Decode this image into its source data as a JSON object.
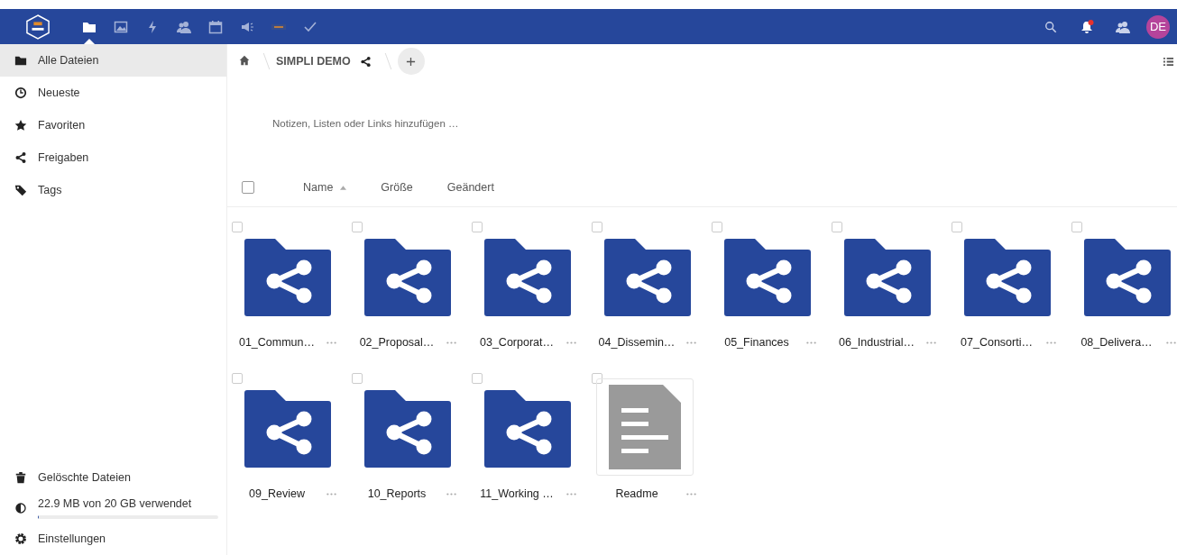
{
  "header": {
    "apps": [
      {
        "kind": "files",
        "selected": true
      },
      {
        "kind": "photos",
        "selected": false
      },
      {
        "kind": "activity",
        "selected": false
      },
      {
        "kind": "contacts",
        "selected": false
      },
      {
        "kind": "calendar",
        "selected": false
      },
      {
        "kind": "announce",
        "selected": false
      },
      {
        "kind": "badge",
        "selected": false
      },
      {
        "kind": "tasks",
        "selected": false
      }
    ],
    "notification_unread": true,
    "avatar": "DE"
  },
  "sidebar": {
    "items": [
      {
        "kind": "folder",
        "label": "Alle Dateien",
        "selected": true
      },
      {
        "kind": "clock",
        "label": "Neueste",
        "selected": false
      },
      {
        "kind": "star",
        "label": "Favoriten",
        "selected": false
      },
      {
        "kind": "share",
        "label": "Freigaben",
        "selected": false
      },
      {
        "kind": "tag",
        "label": "Tags",
        "selected": false
      }
    ],
    "trash": "Gelöschte Dateien",
    "quota": {
      "text": "22.9 MB von 20 GB verwendet",
      "level": 0.0011
    },
    "settings": "Einstellungen"
  },
  "breadcrumb": {
    "folder": "SIMPLI DEMO"
  },
  "notes_placeholder": "Notizen, Listen oder Links hinzufügen …",
  "select_all": {
    "checked": false
  },
  "columns": [
    {
      "label": "Name",
      "sorted": true
    },
    {
      "label": "Größe",
      "sorted": false
    },
    {
      "label": "Geändert",
      "sorted": false
    }
  ],
  "files": [
    {
      "kind": "shared-folder",
      "name": "01_Commun…",
      "checked": false
    },
    {
      "kind": "shared-folder",
      "name": "02_Proposal…",
      "checked": false
    },
    {
      "kind": "shared-folder",
      "name": "03_Corporat…",
      "checked": false
    },
    {
      "kind": "shared-folder",
      "name": "04_Dissemin…",
      "checked": false
    },
    {
      "kind": "shared-folder",
      "name": "05_Finances",
      "checked": false
    },
    {
      "kind": "shared-folder",
      "name": "06_Industrial…",
      "checked": false
    },
    {
      "kind": "shared-folder",
      "name": "07_Consorti…",
      "checked": false
    },
    {
      "kind": "shared-folder",
      "name": "08_Delivera…",
      "checked": false
    },
    {
      "kind": "shared-folder",
      "name": "09_Review",
      "checked": false
    },
    {
      "kind": "shared-folder",
      "name": "10_Reports",
      "checked": false
    },
    {
      "kind": "shared-folder",
      "name": "11_Working …",
      "checked": false
    },
    {
      "kind": "document",
      "name": "Readme",
      "checked": false
    }
  ]
}
